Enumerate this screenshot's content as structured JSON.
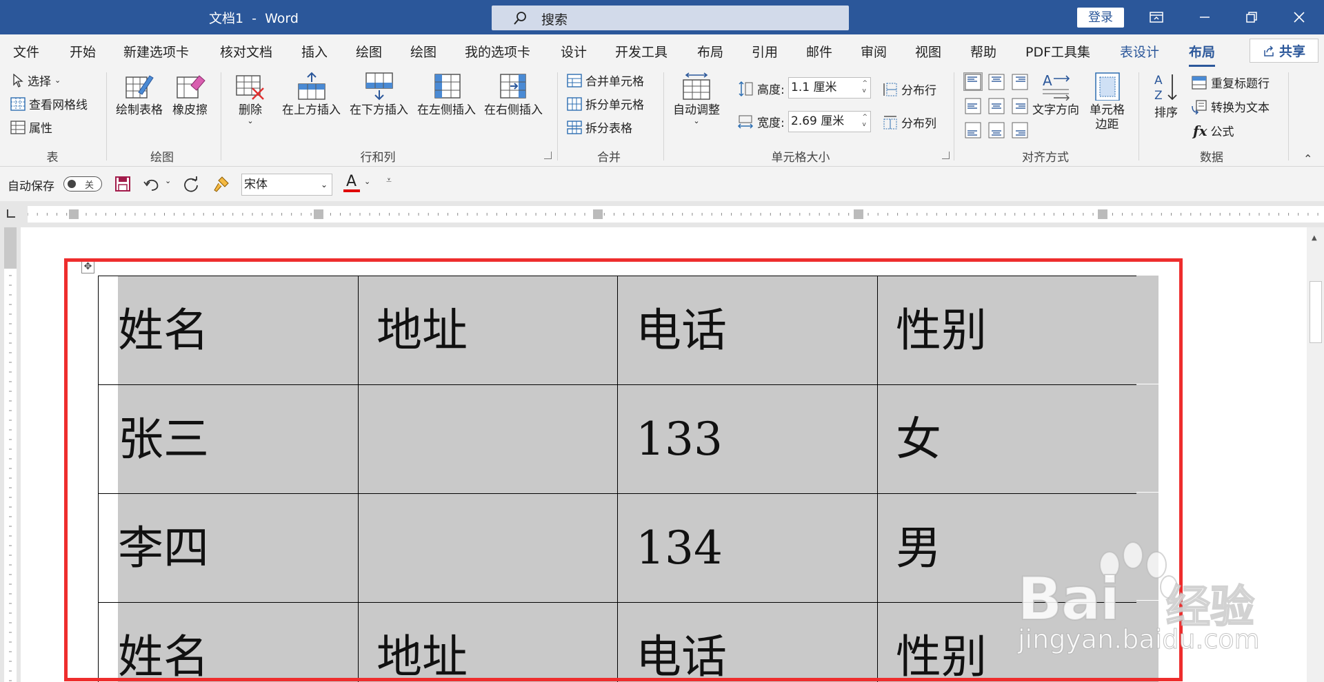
{
  "title_bar": {
    "title": "文档1  -  Word",
    "search_label": "搜索",
    "login_label": "登录"
  },
  "tabs": [
    {
      "label": "文件"
    },
    {
      "label": "开始"
    },
    {
      "label": "新建选项卡"
    },
    {
      "label": "核对文档"
    },
    {
      "label": "插入"
    },
    {
      "label": "绘图"
    },
    {
      "label": "绘图"
    },
    {
      "label": "我的选项卡"
    },
    {
      "label": "设计"
    },
    {
      "label": "开发工具"
    },
    {
      "label": "布局"
    },
    {
      "label": "引用"
    },
    {
      "label": "邮件"
    },
    {
      "label": "审阅"
    },
    {
      "label": "视图"
    },
    {
      "label": "帮助"
    },
    {
      "label": "PDF工具集"
    },
    {
      "label": "表设计"
    },
    {
      "label": "布局"
    }
  ],
  "share_label": "共享",
  "ribbon": {
    "table_group": {
      "label": "表",
      "select": "选择",
      "view_gridlines": "查看网格线",
      "properties": "属性"
    },
    "draw_group": {
      "label": "绘图",
      "draw_table": "绘制表格",
      "eraser": "橡皮擦"
    },
    "rows_cols_group": {
      "label": "行和列",
      "delete": "删除",
      "insert_above": "在上方插入",
      "insert_below": "在下方插入",
      "insert_left": "在左侧插入",
      "insert_right": "在右侧插入"
    },
    "merge_group": {
      "label": "合并",
      "merge_cells": "合并单元格",
      "split_cells": "拆分单元格",
      "split_table": "拆分表格"
    },
    "cell_size_group": {
      "label": "单元格大小",
      "autofit": "自动调整",
      "height_label": "高度:",
      "height_value": "1.1 厘米",
      "width_label": "宽度:",
      "width_value": "2.69 厘米",
      "distribute_rows": "分布行",
      "distribute_cols": "分布列"
    },
    "alignment_group": {
      "label": "对齐方式",
      "text_direction": "文字方向",
      "cell_margins_1": "单元格",
      "cell_margins_2": "边距"
    },
    "data_group": {
      "label": "数据",
      "sort": "排序",
      "repeat_header": "重复标题行",
      "convert_to_text": "转换为文本",
      "formula": "公式"
    }
  },
  "qat": {
    "autosave_label": "自动保存",
    "toggle_state": "关",
    "font_name": "宋体"
  },
  "table": {
    "rows": [
      [
        "姓名",
        "地址",
        "电话",
        "性别"
      ],
      [
        "张三",
        "",
        "133",
        "女"
      ],
      [
        "李四",
        "",
        "134",
        "男"
      ],
      [
        "姓名",
        "地址",
        "电话",
        "性别"
      ]
    ]
  },
  "watermark": {
    "brand": "Bai",
    "brand_cn": "经验",
    "url": "jingyan.baidu.com"
  },
  "colors": {
    "title_bar": "#2b579a",
    "highlight_box": "#ee2d2d",
    "selection": "#c9c9c9"
  }
}
